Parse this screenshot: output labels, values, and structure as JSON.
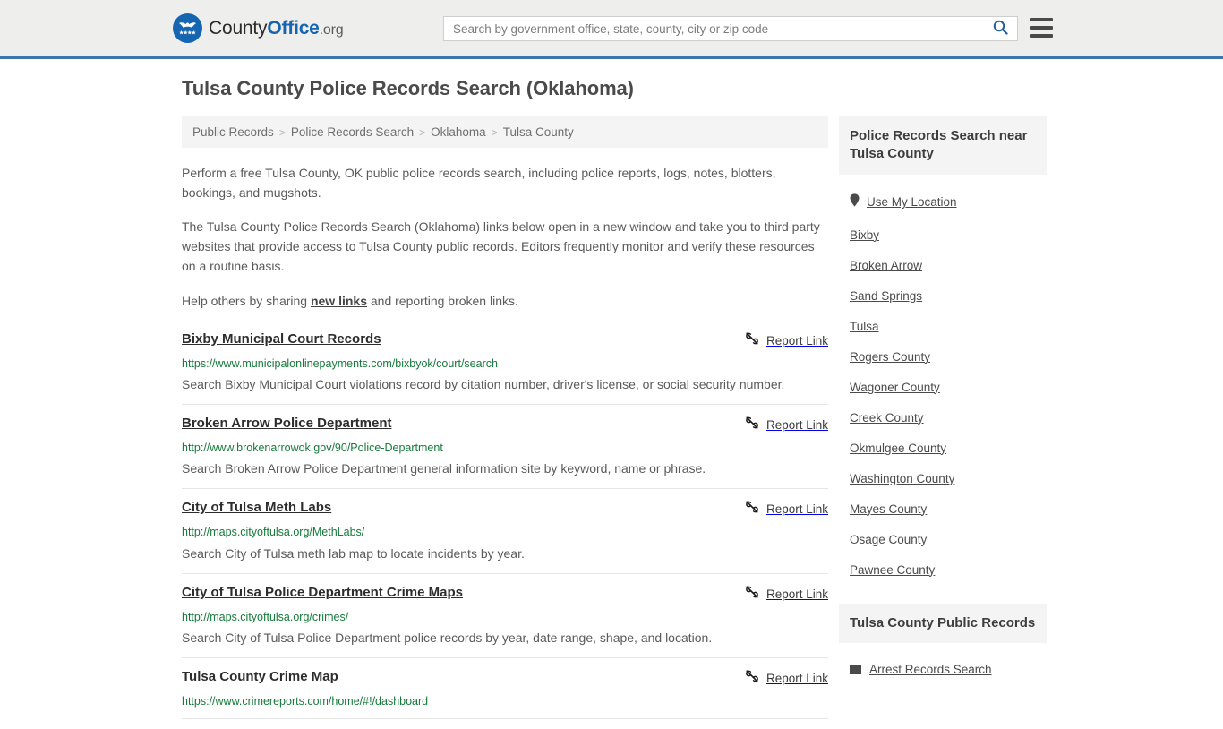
{
  "header": {
    "logo": {
      "part1": "County",
      "part2": "Office",
      "part3": ".org"
    },
    "search": {
      "placeholder": "Search by government office, state, county, city or zip code",
      "value": ""
    },
    "accent_color": "#3c77ab",
    "background_color": "#eeeeec"
  },
  "page": {
    "title": "Tulsa County Police Records Search (Oklahoma)"
  },
  "breadcrumb": {
    "items": [
      {
        "label": "Public Records"
      },
      {
        "label": "Police Records Search"
      },
      {
        "label": "Oklahoma"
      },
      {
        "label": "Tulsa County"
      }
    ],
    "separator": ">"
  },
  "intro": {
    "paragraph1": "Perform a free Tulsa County, OK public police records search, including police reports, logs, notes, blotters, bookings, and mugshots.",
    "paragraph2": "The Tulsa County Police Records Search (Oklahoma) links below open in a new window and take you to third party websites that provide access to Tulsa County public records. Editors frequently monitor and verify these resources on a routine basis.",
    "paragraph3_before": "Help others by sharing ",
    "paragraph3_link": "new links",
    "paragraph3_after": " and reporting broken links."
  },
  "results": {
    "report_link_label": "Report Link",
    "items": [
      {
        "title": "Bixby Municipal Court Records",
        "url": "https://www.municipalonlinepayments.com/bixbyok/court/search",
        "description": "Search Bixby Municipal Court violations record by citation number, driver's license, or social security number."
      },
      {
        "title": "Broken Arrow Police Department",
        "url": "http://www.brokenarrowok.gov/90/Police-Department",
        "description": "Search Broken Arrow Police Department general information site by keyword, name or phrase."
      },
      {
        "title": "City of Tulsa Meth Labs",
        "url": "http://maps.cityoftulsa.org/MethLabs/",
        "description": "Search City of Tulsa meth lab map to locate incidents by year."
      },
      {
        "title": "City of Tulsa Police Department Crime Maps",
        "url": "http://maps.cityoftulsa.org/crimes/",
        "description": "Search City of Tulsa Police Department police records by year, date range, shape, and location."
      },
      {
        "title": "Tulsa County Crime Map",
        "url": "https://www.crimereports.com/home/#!/dashboard",
        "description": ""
      }
    ]
  },
  "sidebar": {
    "nearby": {
      "title": "Police Records Search near Tulsa County",
      "use_my_location": "Use My Location",
      "links": [
        {
          "label": "Bixby"
        },
        {
          "label": "Broken Arrow"
        },
        {
          "label": "Sand Springs"
        },
        {
          "label": "Tulsa"
        },
        {
          "label": "Rogers County"
        },
        {
          "label": "Wagoner County"
        },
        {
          "label": "Creek County"
        },
        {
          "label": "Okmulgee County"
        },
        {
          "label": "Washington County"
        },
        {
          "label": "Mayes County"
        },
        {
          "label": "Osage County"
        },
        {
          "label": "Pawnee County"
        }
      ]
    },
    "public_records": {
      "title": "Tulsa County Public Records",
      "items": [
        {
          "label": "Arrest Records Search"
        }
      ]
    }
  }
}
